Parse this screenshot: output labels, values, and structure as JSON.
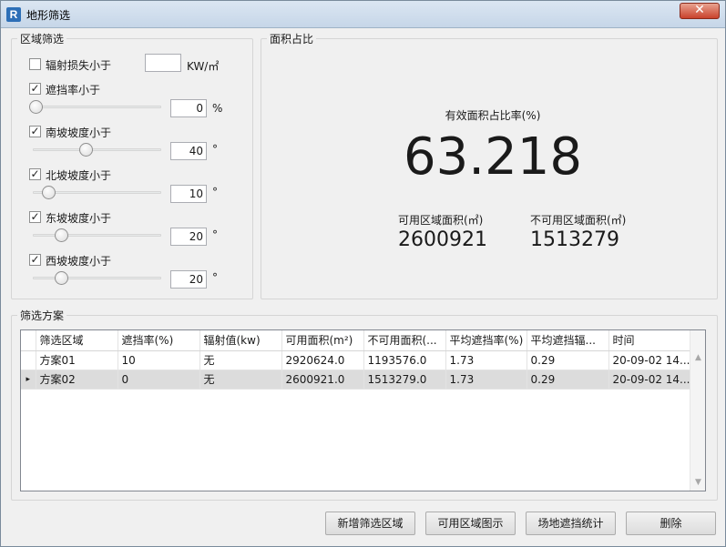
{
  "window": {
    "title": "地形筛选",
    "app_icon": "R",
    "close_glyph": "✕"
  },
  "region_filter": {
    "legend": "区域筛选",
    "radiation": {
      "label": "辐射损失小于",
      "checked": false,
      "value": "",
      "unit": "KW/㎡"
    },
    "shading": {
      "label": "遮挡率小于",
      "checked": true,
      "value": "0",
      "unit": "%",
      "slider_fraction": 0.0
    },
    "south_slope": {
      "label": "南坡坡度小于",
      "checked": true,
      "value": "40",
      "unit": "°",
      "slider_fraction": 0.44
    },
    "north_slope": {
      "label": "北坡坡度小于",
      "checked": true,
      "value": "10",
      "unit": "°",
      "slider_fraction": 0.11
    },
    "east_slope": {
      "label": "东坡坡度小于",
      "checked": true,
      "value": "20",
      "unit": "°",
      "slider_fraction": 0.22
    },
    "west_slope": {
      "label": "西坡坡度小于",
      "checked": true,
      "value": "20",
      "unit": "°",
      "slider_fraction": 0.22
    }
  },
  "area_ratio": {
    "legend": "面积占比",
    "ratio_label": "有效面积占比率(%)",
    "ratio_value": "63.218",
    "usable_label": "可用区域面积(㎡)",
    "usable_value": "2600921",
    "unusable_label": "不可用区域面积(㎡)",
    "unusable_value": "1513279"
  },
  "scheme": {
    "legend": "筛选方案",
    "columns": [
      "筛选区域",
      "遮挡率(%)",
      "辐射值(kw)",
      "可用面积(m²)",
      "不可用面积(...",
      "平均遮挡率(%)",
      "平均遮挡辐...",
      "时间"
    ],
    "rows": [
      [
        "方案01",
        "10",
        "无",
        "2920624.0",
        "1193576.0",
        "1.73",
        "0.29",
        "20-09-02 14..."
      ],
      [
        "方案02",
        "0",
        "无",
        "2600921.0",
        "1513279.0",
        "1.73",
        "0.29",
        "20-09-02 14..."
      ]
    ],
    "selected_row": 1,
    "row_marker": "▸",
    "scroll_up": "▲",
    "scroll_down": "▼"
  },
  "buttons": {
    "add_region": "新增筛选区域",
    "show_usable": "可用区域图示",
    "shading_stats": "场地遮挡统计",
    "delete": "删除"
  },
  "check_glyph": "✓"
}
